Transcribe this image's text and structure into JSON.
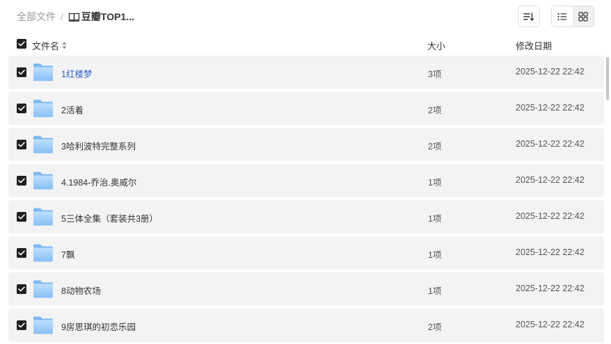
{
  "breadcrumb": {
    "root": "全部文件",
    "separator": "/",
    "current": "豆瓣TOP1..."
  },
  "toolbar": {
    "sort_icon": "sort-icon",
    "list_view_icon": "list-view-icon",
    "grid_view_icon": "grid-view-icon",
    "active_view": "list"
  },
  "table": {
    "headers": {
      "name": "文件名",
      "size": "大小",
      "modified": "修改日期"
    },
    "rows": [
      {
        "name": "1红楼梦",
        "size": "3项",
        "modified": "2025-12-22 22:42",
        "checked": true
      },
      {
        "name": "2活着",
        "size": "2项",
        "modified": "2025-12-22 22:42",
        "checked": true
      },
      {
        "name": "3哈利波特完整系列",
        "size": "2项",
        "modified": "2025-12-22 22:42",
        "checked": true
      },
      {
        "name": "4.1984-乔治.奥威尔",
        "size": "1项",
        "modified": "2025-12-22 22:42",
        "checked": true
      },
      {
        "name": "5三体全集（套装共3册）",
        "size": "1项",
        "modified": "2025-12-22 22:42",
        "checked": true
      },
      {
        "name": "7飘",
        "size": "1项",
        "modified": "2025-12-22 22:42",
        "checked": true
      },
      {
        "name": "8动物农场",
        "size": "1项",
        "modified": "2025-12-22 22:42",
        "checked": true
      },
      {
        "name": "9房思琪的初恋乐园",
        "size": "2项",
        "modified": "2025-12-22 22:42",
        "checked": true
      }
    ]
  },
  "colors": {
    "link": "#2b63c6",
    "row_bg": "#f3f3f3",
    "checkbox": "#1f1f1f",
    "folder_light": "#a9d3fb",
    "folder_dark": "#7db8f3"
  }
}
